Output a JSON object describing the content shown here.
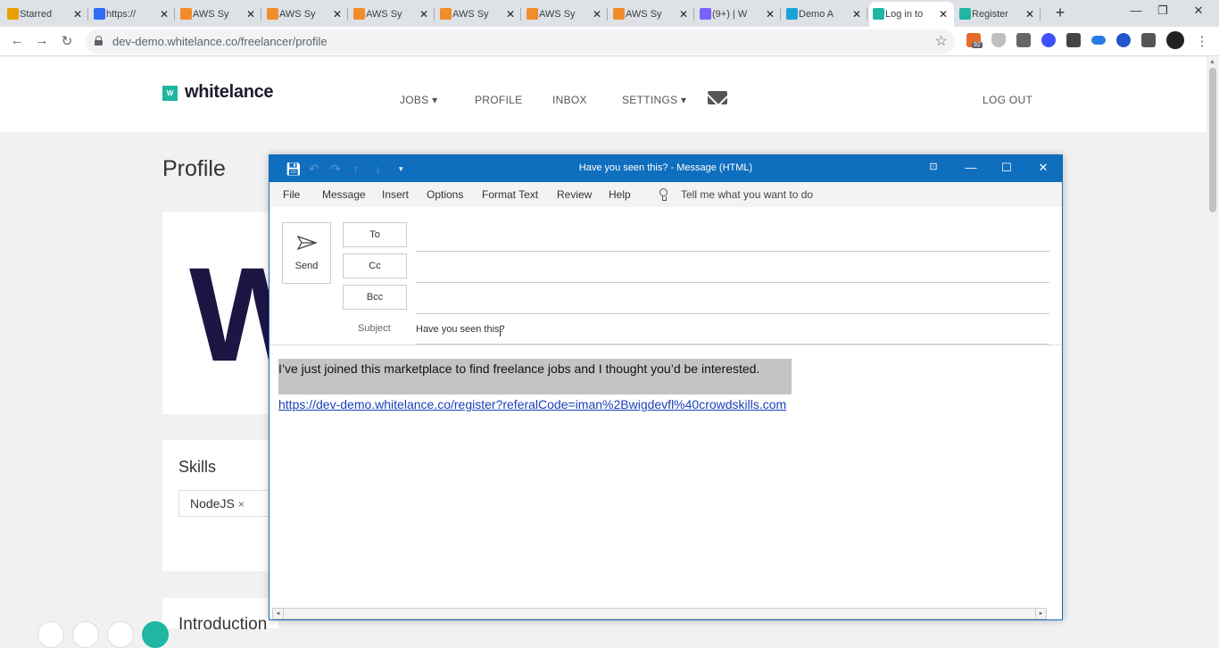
{
  "browser": {
    "tabs": [
      {
        "label": "Starred",
        "color": "#e8a000"
      },
      {
        "label": "https://",
        "color": "#2f6cf6"
      },
      {
        "label": "AWS Sy",
        "color": "#f08c2a"
      },
      {
        "label": "AWS Sy",
        "color": "#f08c2a"
      },
      {
        "label": "AWS Sy",
        "color": "#f08c2a"
      },
      {
        "label": "AWS Sy",
        "color": "#f08c2a"
      },
      {
        "label": "AWS Sy",
        "color": "#f08c2a"
      },
      {
        "label": "AWS Sy",
        "color": "#f08c2a"
      },
      {
        "label": "(9+) | W",
        "color": "#7b61ff"
      },
      {
        "label": "Demo A",
        "color": "#1aa3d6"
      },
      {
        "label": "Log in to",
        "color": "#1fb6a2",
        "active": true
      },
      {
        "label": "Register",
        "color": "#1fb6a2"
      }
    ],
    "new_tab": "+",
    "url": "dev-demo.whitelance.co/freelancer/profile",
    "ext_badge": "92",
    "window": {
      "minimize": "—",
      "restore": "❐",
      "close": "✕"
    }
  },
  "site": {
    "logo_mark": "W",
    "logo_text": "whitelance",
    "nav": {
      "jobs": "JOBS ▾",
      "profile": "PROFILE",
      "inbox": "INBOX",
      "settings": "SETTINGS ▾",
      "logout": "LOG OUT"
    },
    "page_title": "Profile",
    "avatar_letter": "W",
    "skills_heading": "Skills",
    "skill_tag": "NodeJS",
    "skill_remove": "×",
    "intro_heading": "Introduction"
  },
  "outlook": {
    "title": "Have you seen this?  -  Message (HTML)",
    "menu": {
      "file": "File",
      "message": "Message",
      "insert": "Insert",
      "options": "Options",
      "format_text": "Format Text",
      "review": "Review",
      "help": "Help",
      "tell_me": "Tell me what you want to do"
    },
    "send_label": "Send",
    "to_label": "To",
    "cc_label": "Cc",
    "bcc_label": "Bcc",
    "subject_label": "Subject",
    "subject_value": "Have you seen this?",
    "body_text": "I’ve just joined this marketplace to find freelance jobs and I thought you’d be interested.",
    "body_link": "https://dev-demo.whitelance.co/register?referalCode=iman%2Bwigdevfl%40crowdskills.com"
  },
  "colors": {
    "outlook_blue": "#106ebe",
    "brand_teal": "#1fb6a2",
    "brand_navy": "#1c1645"
  }
}
